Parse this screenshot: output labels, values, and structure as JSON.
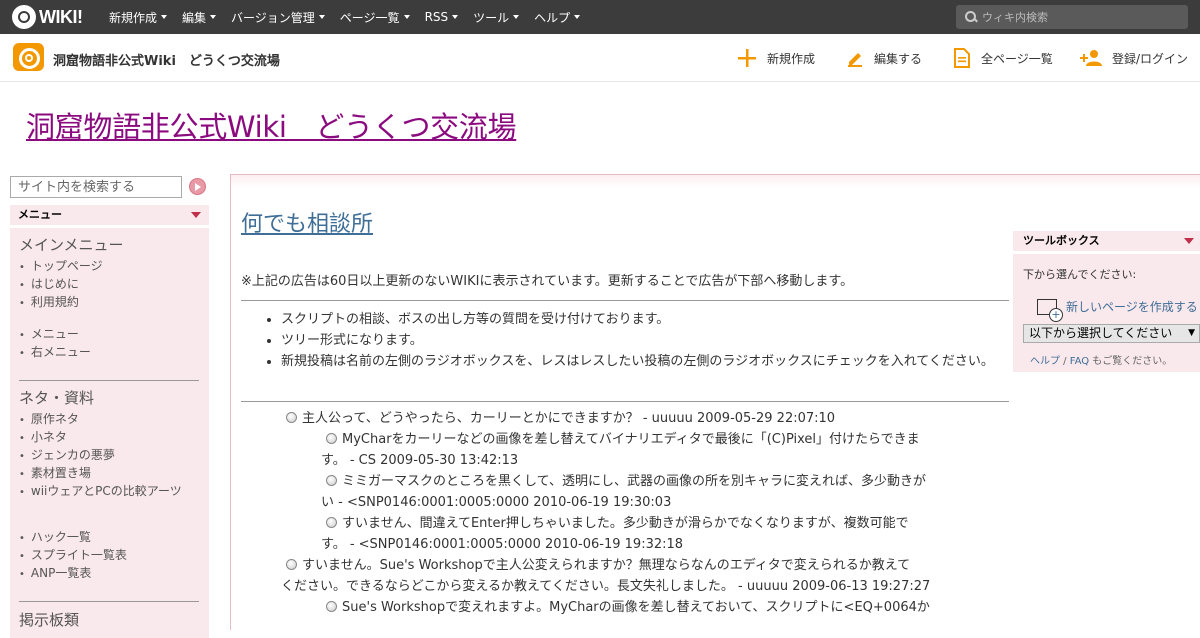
{
  "topbar": {
    "logo_text": "WIKI!",
    "nav": [
      "新規作成",
      "編集",
      "バージョン管理",
      "ページ一覧",
      "RSS",
      "ツール",
      "ヘルプ"
    ],
    "search_placeholder": "ウィキ内検索"
  },
  "header": {
    "site_name": "洞窟物語非公式Wiki　どうくつ交流場",
    "actions": {
      "new": "新規作成",
      "edit": "編集する",
      "all_pages": "全ページ一覧",
      "login": "登録/ログイン"
    }
  },
  "title": "洞窟物語非公式Wiki　どうくつ交流場",
  "sidebar": {
    "search_placeholder": "サイト内を検索する",
    "menu_head": "メニュー",
    "sections": [
      {
        "title": "メインメニュー",
        "items": [
          "トップページ",
          "はじめに",
          "利用規約"
        ]
      },
      {
        "items": [
          "メニュー",
          "右メニュー"
        ]
      },
      {
        "title": "ネタ・資料",
        "items": [
          "原作ネタ",
          "小ネタ",
          "ジェンカの悪夢",
          "素材置き場",
          "wiiウェアとPCの比較アーツ"
        ]
      },
      {
        "items": [
          "ハック一覧",
          "スプライト一覧表",
          "ANP一覧表"
        ]
      },
      {
        "title": "掲示板類"
      }
    ]
  },
  "main": {
    "page_title": "何でも相談所",
    "notice": "※上記の広告は60日以上更新のないWIKIに表示されています。更新することで広告が下部へ移動します。",
    "bullets": [
      "スクリプトの相談、ボスの出し方等の質問を受け付けております。",
      "ツリー形式になります。",
      "新規投稿は名前の左側のラジオボックスを、レスはレスしたい投稿の左側のラジオボックスにチェックを入れてください。"
    ],
    "posts": [
      {
        "l1": "主人公って、どうやったら、カーリーとかにできますか？ - uuuuu 2009-05-29 22:07:10"
      },
      {
        "l1": "MyCharをカーリーなどの画像を差し替えてバイナリエディタで最後に「(C)Pixel」付けたらできま",
        "l2": "す。 - CS 2009-05-30 13:42:13"
      },
      {
        "l1": "ミミガーマスクのところを黒くして、透明にし、武器の画像の所を別キャラに変えれば、多少動きが",
        "l2": "い - <SNP0146:0001:0005:0000 2010-06-19 19:30:03"
      },
      {
        "l1": "すいません、間違えてEnter押しちゃいました。多少動きが滑らかでなくなりますが、複数可能で",
        "l2": "す。 - <SNP0146:0001:0005:0000 2010-06-19 19:32:18"
      },
      {
        "l1": "すいません。Sue's Workshopで主人公変えられますか？無理ならなんのエディタで変えられるか教えて",
        "l2": "ください。できるならどこから変えるか教えてください。長文失礼しました。 - uuuuu 2009-06-13 19:27:27"
      },
      {
        "l1": "Sue's Workshopで変えれますよ。MyCharの画像を差し替えておいて、スクリプトに<EQ+0064か"
      }
    ]
  },
  "toolbox": {
    "head": "ツールボックス",
    "label": "下から選んでください:",
    "new_page": "新しいページを作成する",
    "select": "以下から選択してください",
    "help": "ヘルプ",
    "sep": " / ",
    "faq": "FAQ",
    "help_suffix": " もご覧ください。"
  },
  "colors": {
    "accent": "#f39800",
    "title": "#8b0a7f",
    "link": "#3f6e97",
    "pink": "#f9e8ec",
    "topbar": "#3c3c3c"
  }
}
